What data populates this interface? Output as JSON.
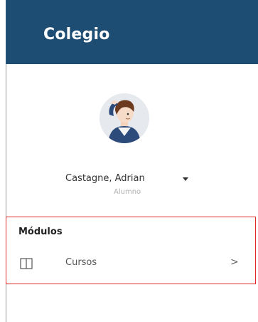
{
  "header": {
    "title": "Colegio",
    "background": "#1e4d73"
  },
  "user": {
    "name": "Castagne, Adrian",
    "role": "Alumno",
    "avatar_icon": "student-avatar-icon",
    "dropdown_icon": "caret-down-icon"
  },
  "sidebar": {
    "section_label": "Módulos",
    "items": [
      {
        "label": "Cursos",
        "icon": "book-open-icon",
        "chevron": ">"
      }
    ]
  },
  "colors": {
    "highlight": "#e02a2a",
    "brand": "#1e4d73"
  }
}
